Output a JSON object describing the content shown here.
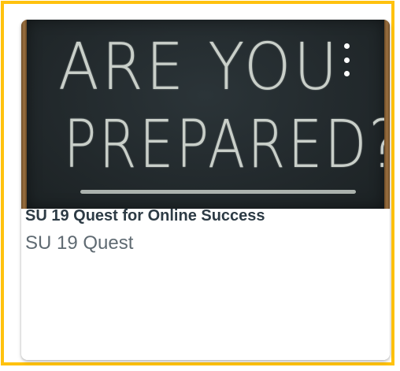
{
  "card": {
    "hero_image": {
      "line_1": "ARE YOU",
      "line_2": "PREPARED?",
      "background_color": "#22292c",
      "frame_color": "#8a6336"
    },
    "options_icon": "vertical-ellipsis-icon",
    "title": "SU 19 Quest for Online Success",
    "subtitle": "SU 19 Quest"
  },
  "colors": {
    "focus_border": "#ffc20e",
    "title": "#2d3b45",
    "subtitle": "#5f6a72"
  }
}
